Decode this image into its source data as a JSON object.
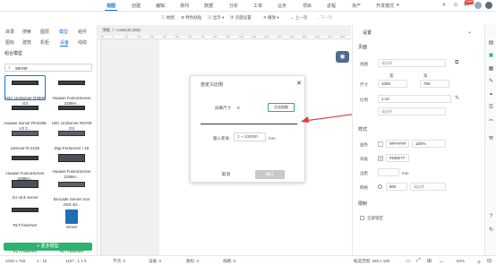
{
  "menubar": {
    "items": [
      "视图",
      "创建",
      "编辑",
      "排列",
      "数据",
      "分析",
      "工单",
      "业务",
      "项目",
      "返程",
      "资产",
      "开发模式"
    ],
    "active": "视图",
    "notification_count": "1099",
    "dropdown_arrow": "▾"
  },
  "toolbar": {
    "items": [
      "地图",
      "特色粘贴",
      "显示",
      "页面设置",
      "播放",
      "上一页",
      "下一页"
    ]
  },
  "left": {
    "tabs1": [
      "目录",
      "搜索",
      "图层",
      "模型",
      "组件"
    ],
    "tabs1_active": "模型",
    "tabs2": [
      "图标",
      "建筑",
      "机柜",
      "设备",
      "线缆"
    ],
    "tabs2_active": "设备",
    "group_title": "组合模型",
    "search_value": "server",
    "items": [
      {
        "label": "H3C UniServer R4900 G3"
      },
      {
        "label": "Huawei FusionServer 2288H..."
      },
      {
        "label": "Huawei Server RH2288 V3 2..."
      },
      {
        "label": "H3C UniServer R6700 G3"
      },
      {
        "label": "aServer-R-2105"
      },
      {
        "label": "Digi Portserver I 16"
      },
      {
        "label": "Huawei FusionServer 2288H..."
      },
      {
        "label": "Huawei FusionServer 2288H..."
      },
      {
        "label": "2U rack server"
      },
      {
        "label": "Brocade Server Iron ADX 40..."
      },
      {
        "label": "RLT-hsserver"
      },
      {
        "label": "server"
      },
      {
        "label": "RLT-hsserver"
      },
      {
        "label": "RLT-hsserver"
      }
    ],
    "more_button": "+ 更多模型"
  },
  "canvas": {
    "tab_title": "顶级 ＞ node(40,258)",
    "ruler_ticks": [
      "-100",
      "0",
      "100",
      "200",
      "300",
      "400",
      "500",
      "600",
      "700",
      "800",
      "900",
      "1000",
      "1100",
      "1200",
      "1300",
      "1400",
      "1500",
      "1600",
      "1700",
      "1800"
    ]
  },
  "dialog": {
    "title": "自定义比例",
    "close": "✕",
    "screen_size_label": "屏幕尺寸",
    "screen_size_value": "0",
    "pick_button": "点击拾取",
    "distance_label": "输入距离:",
    "distance_placeholder": "1 ~ 100000",
    "distance_unit": "mm",
    "cancel": "取消",
    "ok": "确认"
  },
  "right_panel": {
    "title": "设置",
    "close": "⌄",
    "page_section": "页面",
    "view_label": "视图",
    "view_placeholder": "请选择",
    "width_label": "宽",
    "height_label": "高",
    "size_label": "尺寸",
    "width_value": "1000",
    "height_value": "750",
    "scale_label": "比例",
    "scale_value": "1:10",
    "scale2_placeholder": "请选择",
    "style_section": "样式",
    "page_color_label": "画色",
    "page_color_value": "#FFFFFF",
    "page_opacity": "100%",
    "bg_label": "背板",
    "bg_color_value": "#DDD77",
    "margin_label": "边距",
    "margin_unit": "mm",
    "grid_label": "网格",
    "grid_value": "800",
    "grid_placeholder": "请选择",
    "limit_section": "限制",
    "lock_all_label": "全部锁定"
  },
  "status": {
    "size": "1000 x 750",
    "scale": "1 : 10",
    "coords": "1157 , 1 1 0",
    "nodes": "节点: 0",
    "devices": "设备: 0",
    "icons": "图标: 0",
    "lines": "线路: 0",
    "selection": "框选范围: 285 x 185",
    "zoom": "83%"
  }
}
